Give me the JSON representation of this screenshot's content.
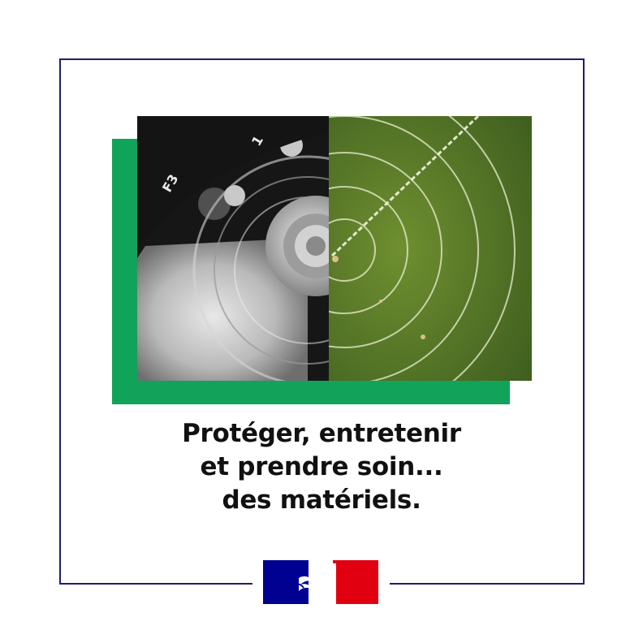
{
  "colors": {
    "frame": "#1f1f6b",
    "accent_green": "#12a35a",
    "flag_blue": "#000091",
    "flag_red": "#e1000f",
    "text": "#111111"
  },
  "photo": {
    "left_half": "grayscale close-up of a metal dial with markings",
    "right_half": "aerial view of a green field with concentric circles",
    "left_markings": [
      "F3",
      "1"
    ]
  },
  "headline": {
    "line1": "Protéger, entretenir",
    "line2": "et prendre soin...",
    "line3": "des matériels."
  },
  "logo": {
    "name": "marianne-logo-icon"
  }
}
